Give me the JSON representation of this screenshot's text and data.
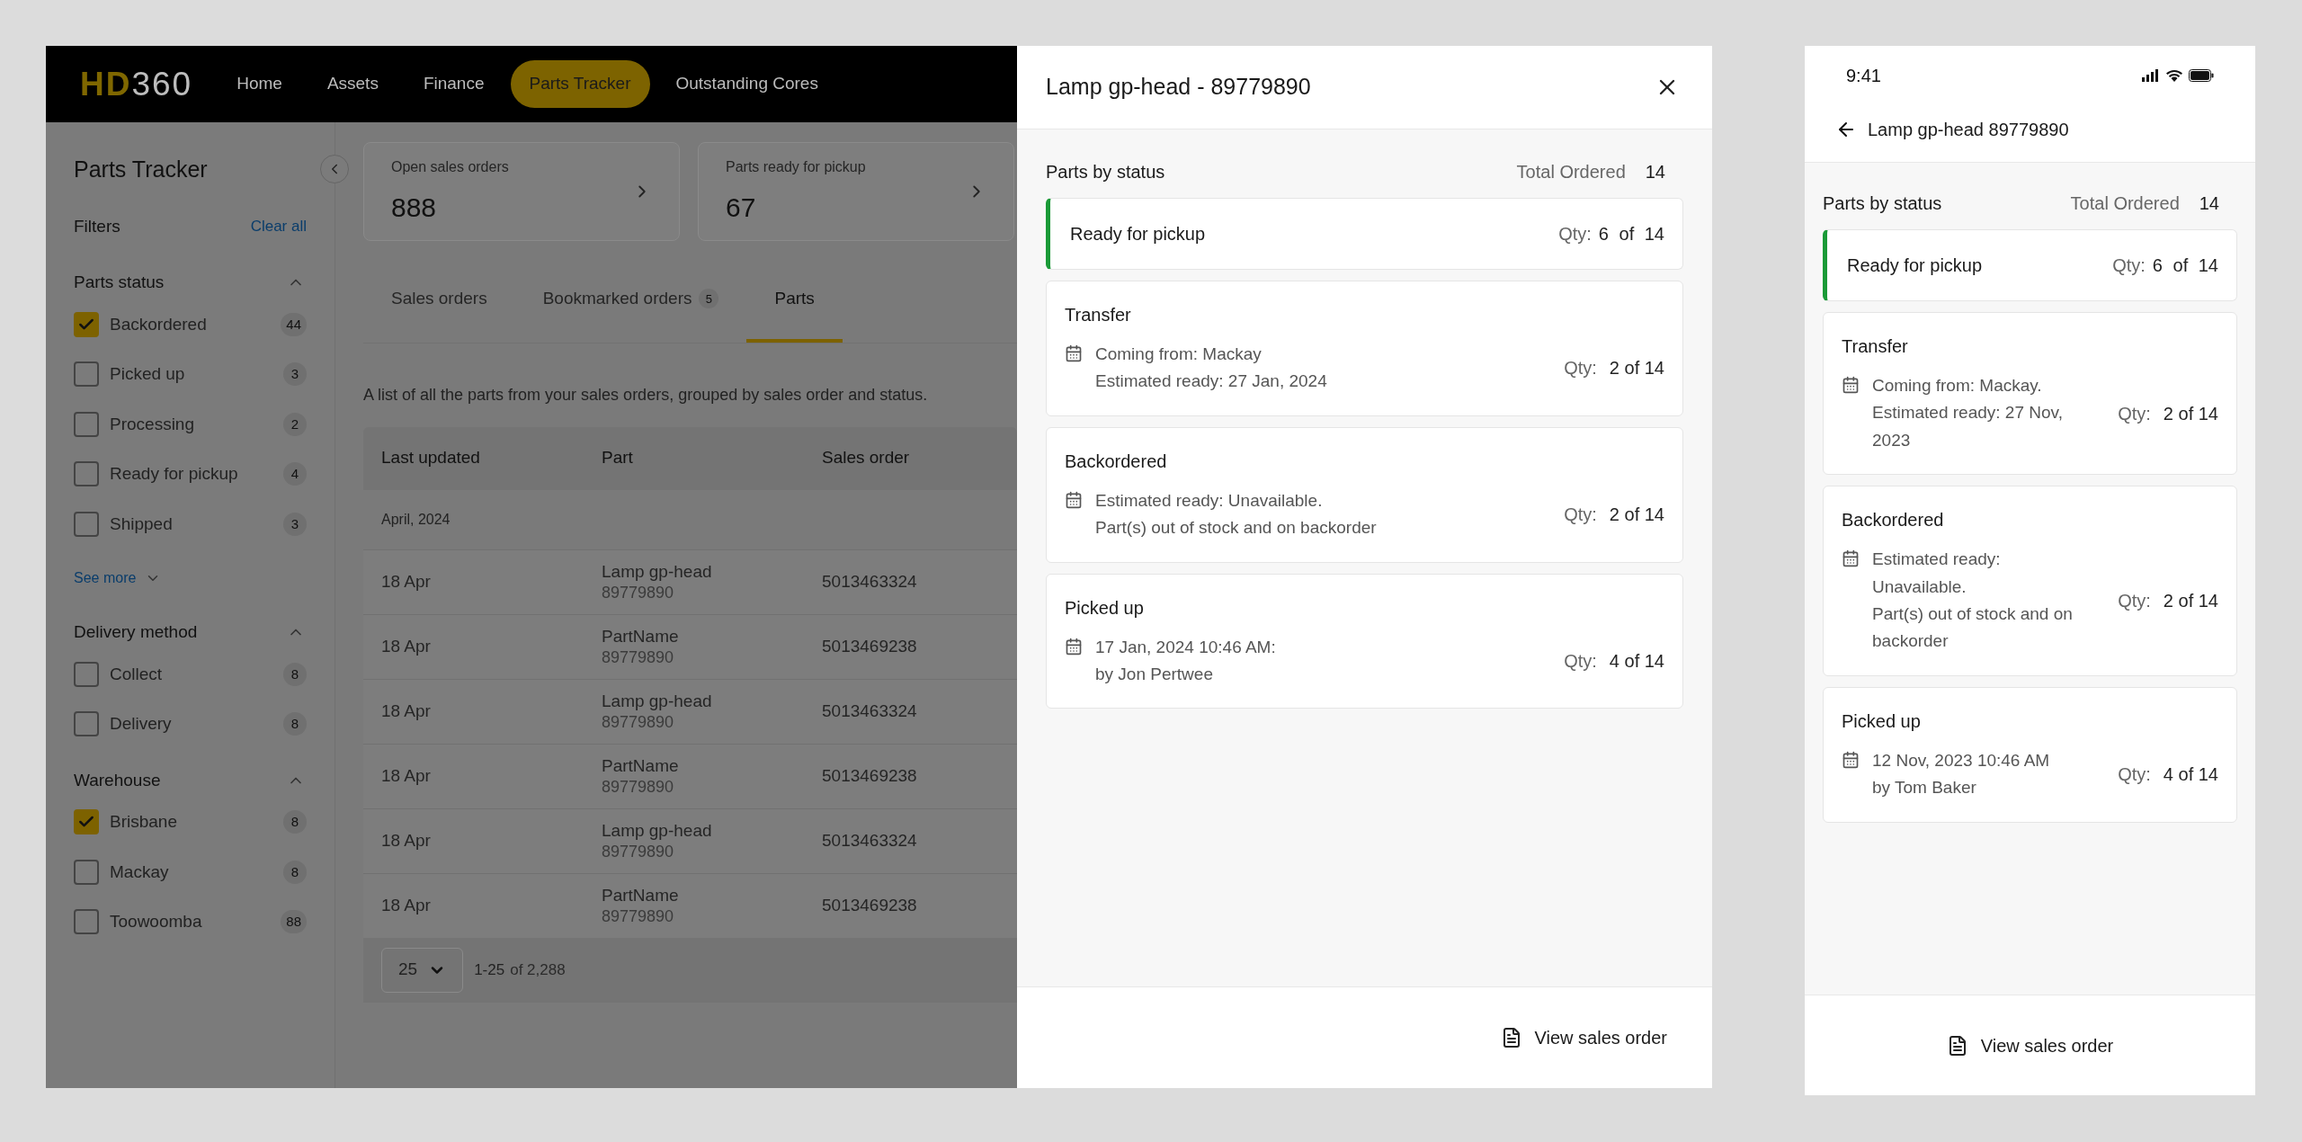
{
  "desktop": {
    "nav": {
      "logo_prefix": "HD",
      "logo_suffix": "360",
      "items": [
        {
          "label": "Home",
          "selected": false
        },
        {
          "label": "Assets",
          "selected": false
        },
        {
          "label": "Finance",
          "selected": false
        },
        {
          "label": "Parts Tracker",
          "selected": true
        },
        {
          "label": "Outstanding Cores",
          "selected": false
        }
      ]
    },
    "sidebar": {
      "title": "Parts Tracker",
      "filters_label": "Filters",
      "clear_all": "Clear all",
      "groups": [
        {
          "title": "Parts status",
          "expanded": true,
          "see_more": "See more",
          "options": [
            {
              "label": "Backordered",
              "count": "44",
              "checked": true
            },
            {
              "label": "Picked up",
              "count": "3",
              "checked": false
            },
            {
              "label": "Processing",
              "count": "2",
              "checked": false
            },
            {
              "label": "Ready for pickup",
              "count": "4",
              "checked": false
            },
            {
              "label": "Shipped",
              "count": "3",
              "checked": false
            }
          ]
        },
        {
          "title": "Delivery method",
          "expanded": true,
          "options": [
            {
              "label": "Collect",
              "count": "8",
              "checked": false
            },
            {
              "label": "Delivery",
              "count": "8",
              "checked": false
            }
          ]
        },
        {
          "title": "Warehouse",
          "expanded": true,
          "options": [
            {
              "label": "Brisbane",
              "count": "8",
              "checked": true
            },
            {
              "label": "Mackay",
              "count": "8",
              "checked": false
            },
            {
              "label": "Toowoomba",
              "count": "88",
              "checked": false
            }
          ]
        }
      ]
    },
    "summary_cards": [
      {
        "label": "Open sales orders",
        "value": "888"
      },
      {
        "label": "Parts ready for pickup",
        "value": "67"
      }
    ],
    "tabs": [
      {
        "label": "Sales orders",
        "selected": false
      },
      {
        "label": "Bookmarked orders",
        "badge": "5",
        "selected": false
      },
      {
        "label": "Parts",
        "selected": true
      }
    ],
    "description": "A list of all the parts from your sales orders, grouped by sales order and status.",
    "table": {
      "columns": [
        "Last updated",
        "Part",
        "Sales order"
      ],
      "group": "April, 2024",
      "rows": [
        {
          "last_updated": "18 Apr",
          "part_name": "Lamp gp-head",
          "part_number": "89779890",
          "sales_order": "5013463324"
        },
        {
          "last_updated": "18 Apr",
          "part_name": "PartName",
          "part_number": "89779890",
          "sales_order": "5013469238"
        },
        {
          "last_updated": "18 Apr",
          "part_name": "Lamp gp-head",
          "part_number": "89779890",
          "sales_order": "5013463324"
        },
        {
          "last_updated": "18 Apr",
          "part_name": "PartName",
          "part_number": "89779890",
          "sales_order": "5013469238"
        },
        {
          "last_updated": "18 Apr",
          "part_name": "Lamp gp-head",
          "part_number": "89779890",
          "sales_order": "5013463324"
        },
        {
          "last_updated": "18 Apr",
          "part_name": "PartName",
          "part_number": "89779890",
          "sales_order": "5013469238"
        }
      ]
    },
    "pagination": {
      "page_size": "25",
      "range": "1-25",
      "total": "of 2,288"
    }
  },
  "drawer": {
    "title": "Lamp gp-head - 89779890",
    "section_title": "Parts by status",
    "total_label": "Total Ordered",
    "total": "14",
    "statuses": [
      {
        "kind": "ready",
        "title": "Ready for pickup",
        "qty_label": "Qty:",
        "qty": "6 of 14"
      },
      {
        "kind": "detail",
        "title": "Transfer",
        "lines": [
          "Coming from: Mackay",
          "Estimated ready: 27 Jan, 2024"
        ],
        "qty_label": "Qty:",
        "qty": "2 of 14"
      },
      {
        "kind": "detail",
        "title": "Backordered",
        "lines": [
          "Estimated ready: Unavailable.",
          "Part(s) out of stock and on backorder"
        ],
        "qty_label": "Qty:",
        "qty": "2 of 14"
      },
      {
        "kind": "detail",
        "title": "Picked up",
        "lines": [
          "17 Jan, 2024 10:46 AM:",
          "by Jon Pertwee"
        ],
        "qty_label": "Qty:",
        "qty": "4 of 14"
      }
    ],
    "footer_button": "View sales order"
  },
  "mobile": {
    "time": "9:41",
    "title": "Lamp gp-head 89779890",
    "section_title": "Parts by status",
    "total_label": "Total Ordered",
    "total": "14",
    "statuses": [
      {
        "kind": "ready",
        "title": "Ready for pickup",
        "qty_label": "Qty:",
        "qty": "6 of 14"
      },
      {
        "kind": "detail",
        "title": "Transfer",
        "lines": [
          "Coming from: Mackay.",
          "Estimated ready: 27 Nov, 2023"
        ],
        "qty_label": "Qty:",
        "qty": "2 of 14"
      },
      {
        "kind": "detail",
        "title": "Backordered",
        "lines": [
          "Estimated ready: Unavailable.",
          "Part(s) out of stock and on backorder"
        ],
        "qty_label": "Qty:",
        "qty": "2 of 14"
      },
      {
        "kind": "detail",
        "title": "Picked up",
        "lines": [
          "12 Nov, 2023 10:46 AM",
          "by Tom Baker"
        ],
        "qty_label": "Qty:",
        "qty": "4 of 14"
      }
    ],
    "footer_button": "View sales order"
  }
}
